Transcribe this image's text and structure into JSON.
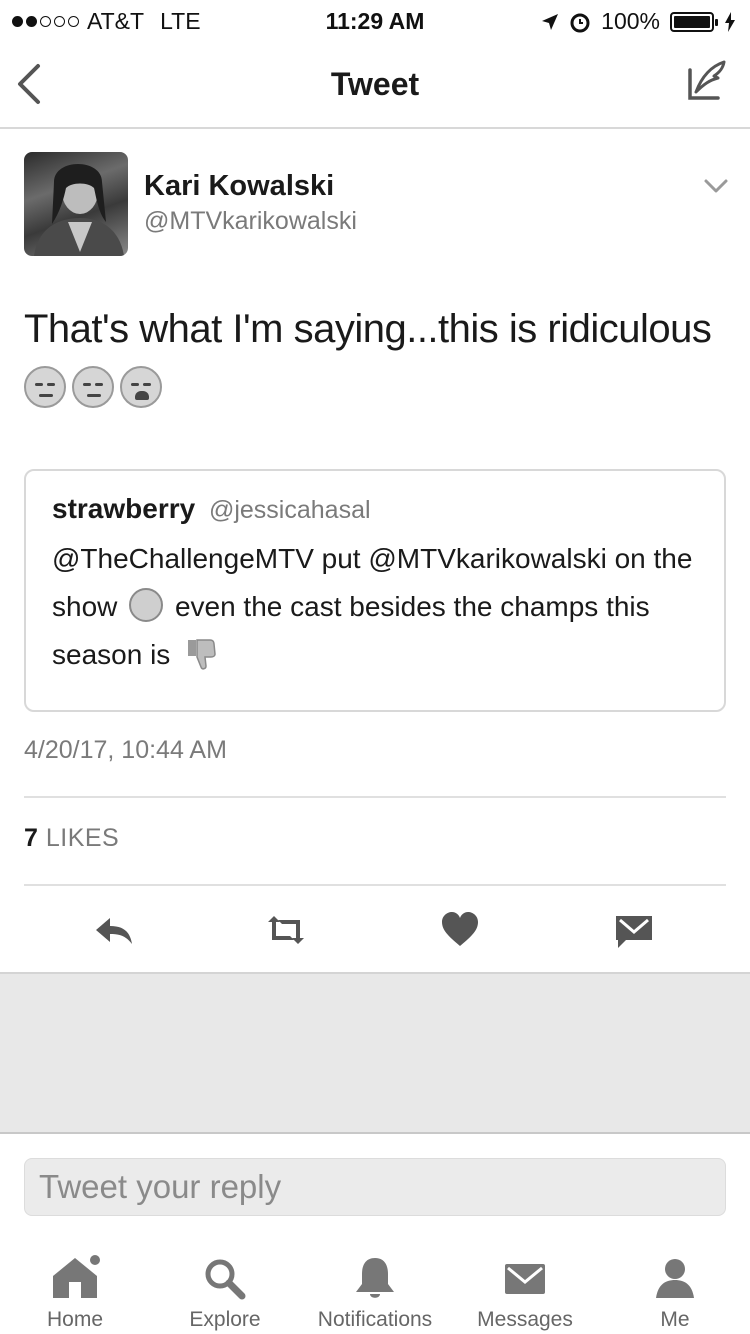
{
  "status_bar": {
    "carrier": "AT&T",
    "network": "LTE",
    "time": "11:29 AM",
    "battery": "100%"
  },
  "nav": {
    "title": "Tweet",
    "back_icon": "chevron-left-icon",
    "compose_icon": "compose-tweet-icon"
  },
  "tweet": {
    "author_name": "Kari Kowalski",
    "author_handle": "@MTVkarikowalski",
    "text": "That's what I'm saying...this is ridiculous",
    "emojis": [
      "unamused-face-icon",
      "unamused-face-icon",
      "weary-face-icon"
    ],
    "quoted": {
      "name": "strawberry",
      "handle": "@jessicahasal",
      "text_part1": "@TheChallengeMTV put @MTVkarikowalski on the show",
      "text_part2": "even the cast besides the champs this season is"
    },
    "timestamp": "4/20/17, 10:44 AM",
    "likes_count": "7",
    "likes_label": "LIKES"
  },
  "actions": [
    "reply-icon",
    "retweet-icon",
    "like-icon",
    "direct-message-icon"
  ],
  "reply": {
    "placeholder": "Tweet your reply"
  },
  "tabs": [
    {
      "label": "Home",
      "icon": "home-icon"
    },
    {
      "label": "Explore",
      "icon": "search-icon"
    },
    {
      "label": "Notifications",
      "icon": "bell-icon"
    },
    {
      "label": "Messages",
      "icon": "envelope-icon"
    },
    {
      "label": "Me",
      "icon": "person-icon"
    }
  ],
  "colors": {
    "text": "#1a1a1a",
    "secondary": "#7a7a7a",
    "divider": "#d8d8d8",
    "background_gray": "#e8e8e8"
  }
}
